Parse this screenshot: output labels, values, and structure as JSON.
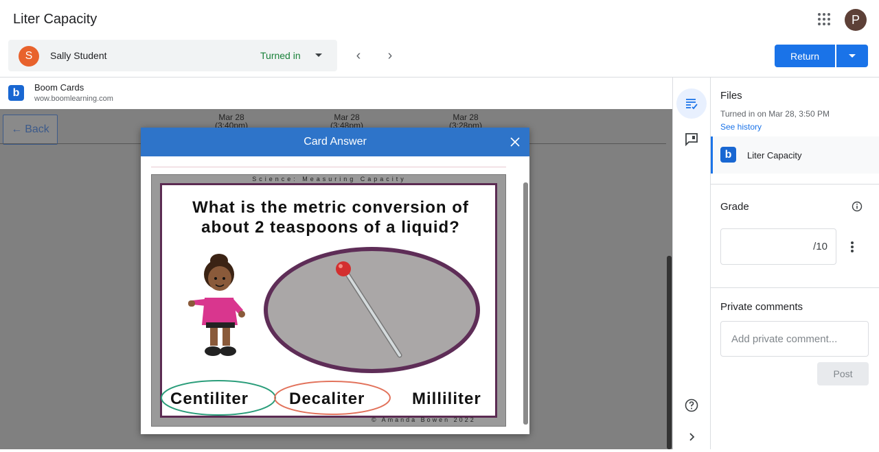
{
  "header": {
    "title": "Liter Capacity",
    "account_initial": "P"
  },
  "student": {
    "initial": "S",
    "name": "Sally Student",
    "status": "Turned in"
  },
  "nav": {
    "prev": "‹",
    "next": "›"
  },
  "actions": {
    "return_label": "Return"
  },
  "attachment": {
    "logo": "b",
    "title": "Boom Cards",
    "url": "wow.boomlearning.com"
  },
  "viewer": {
    "back_label": "Back",
    "dates": [
      {
        "date": "Mar 28",
        "time": "(3:40pm)"
      },
      {
        "date": "Mar 28",
        "time": "(3:48pm)"
      },
      {
        "date": "Mar 28",
        "time": "(3:28pm)"
      }
    ]
  },
  "modal": {
    "title": "Card Answer",
    "card": {
      "category": "Science: Measuring Capacity",
      "question_line1": "What is the metric conversion of",
      "question_line2": "about 2 teaspoons of a liquid?",
      "answers": [
        "Centiliter",
        "Decaliter",
        "Milliliter"
      ],
      "copyright": "© Amanda Bowen 2022"
    }
  },
  "panel": {
    "files_heading": "Files",
    "turned_in": "Turned in on Mar 28, 3:50 PM",
    "see_history": "See history",
    "file_logo": "b",
    "file_name": "Liter Capacity",
    "grade_heading": "Grade",
    "grade_denominator": "/10",
    "comments_heading": "Private comments",
    "comment_placeholder": "Add private comment...",
    "post_label": "Post"
  },
  "colors": {
    "primary": "#1a73e8",
    "status_green": "#188038",
    "modal_header": "#2e74c9",
    "card_border": "#5b2b52"
  },
  "icons": {
    "apps": "apps-grid-icon",
    "close": "close-icon",
    "rubric": "assignment-list-icon",
    "comment": "feedback-icon",
    "help": "help-icon",
    "expand": "chevron-right-icon",
    "info": "info-icon",
    "more": "more-vert-icon"
  }
}
